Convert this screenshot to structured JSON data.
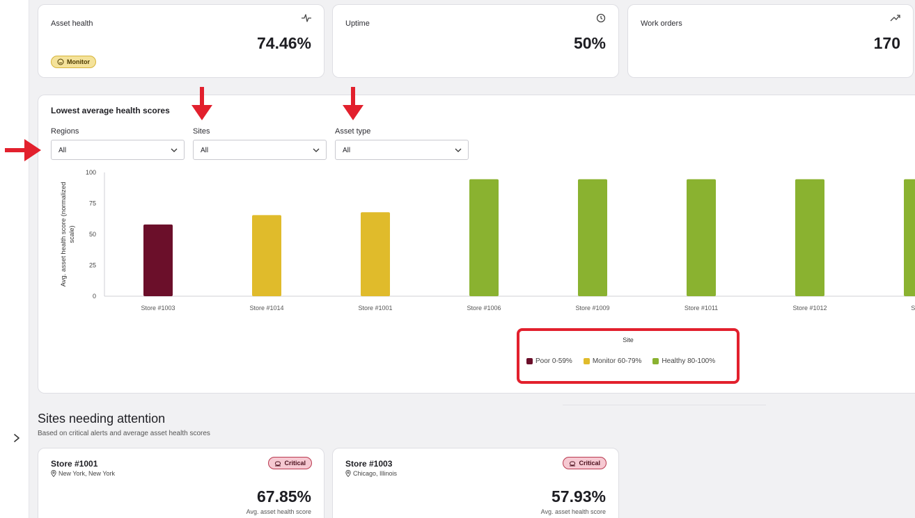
{
  "kpis": [
    {
      "label": "Asset health",
      "value": "74.46%",
      "badge": "Monitor",
      "icon": "pulse-icon"
    },
    {
      "label": "Uptime",
      "value": "50%",
      "icon": "clock-icon"
    },
    {
      "label": "Work orders",
      "value": "170",
      "icon": "trend-up-icon"
    }
  ],
  "chart_section": {
    "title": "Lowest average health scores",
    "filters": [
      {
        "label": "Regions",
        "value": "All"
      },
      {
        "label": "Sites",
        "value": "All"
      },
      {
        "label": "Asset type",
        "value": "All"
      }
    ]
  },
  "chart_data": {
    "type": "bar",
    "title": "",
    "ylabel": "Avg. asset health score (normalized scale)",
    "ylabel_lines": [
      "Avg. asset health score (normalized",
      "scale)"
    ],
    "xlabel": "",
    "ylim": [
      0,
      100
    ],
    "yticks": [
      "100",
      "75",
      "50",
      "25",
      "0"
    ],
    "categories": [
      "Store #1003",
      "Store #1014",
      "Store #1001",
      "Store #1006",
      "Store #1009",
      "Store #1011",
      "Store #1012",
      "Store"
    ],
    "values": [
      57.93,
      65.5,
      67.85,
      94.5,
      94.5,
      94.5,
      94.5,
      94.5
    ],
    "bar_status": [
      "poor",
      "monitor",
      "monitor",
      "healthy",
      "healthy",
      "healthy",
      "healthy",
      "healthy"
    ],
    "legend_title": "Site",
    "legend": [
      {
        "key": "poor",
        "label": "Poor 0-59%",
        "color": "#6b0f2a"
      },
      {
        "key": "monitor",
        "label": "Monitor 60-79%",
        "color": "#e0bb2b"
      },
      {
        "key": "healthy",
        "label": "Healthy 80-100%",
        "color": "#8ab230"
      }
    ],
    "grid": false,
    "legend_position": "bottom"
  },
  "sites_section": {
    "title": "Sites needing attention",
    "subtitle": "Based on critical alerts and average asset health scores",
    "sites": [
      {
        "name": "Store #1001",
        "location": "New York, New York",
        "badge": "Critical",
        "value": "67.85%",
        "caption": "Avg. asset health score"
      },
      {
        "name": "Store #1003",
        "location": "Chicago, Illinois",
        "badge": "Critical",
        "value": "57.93%",
        "caption": "Avg. asset health score"
      }
    ]
  },
  "colors": {
    "accent_red": "#e2202d",
    "critical_bg": "#f6c9d2",
    "monitor_bg": "#f4e29a"
  }
}
